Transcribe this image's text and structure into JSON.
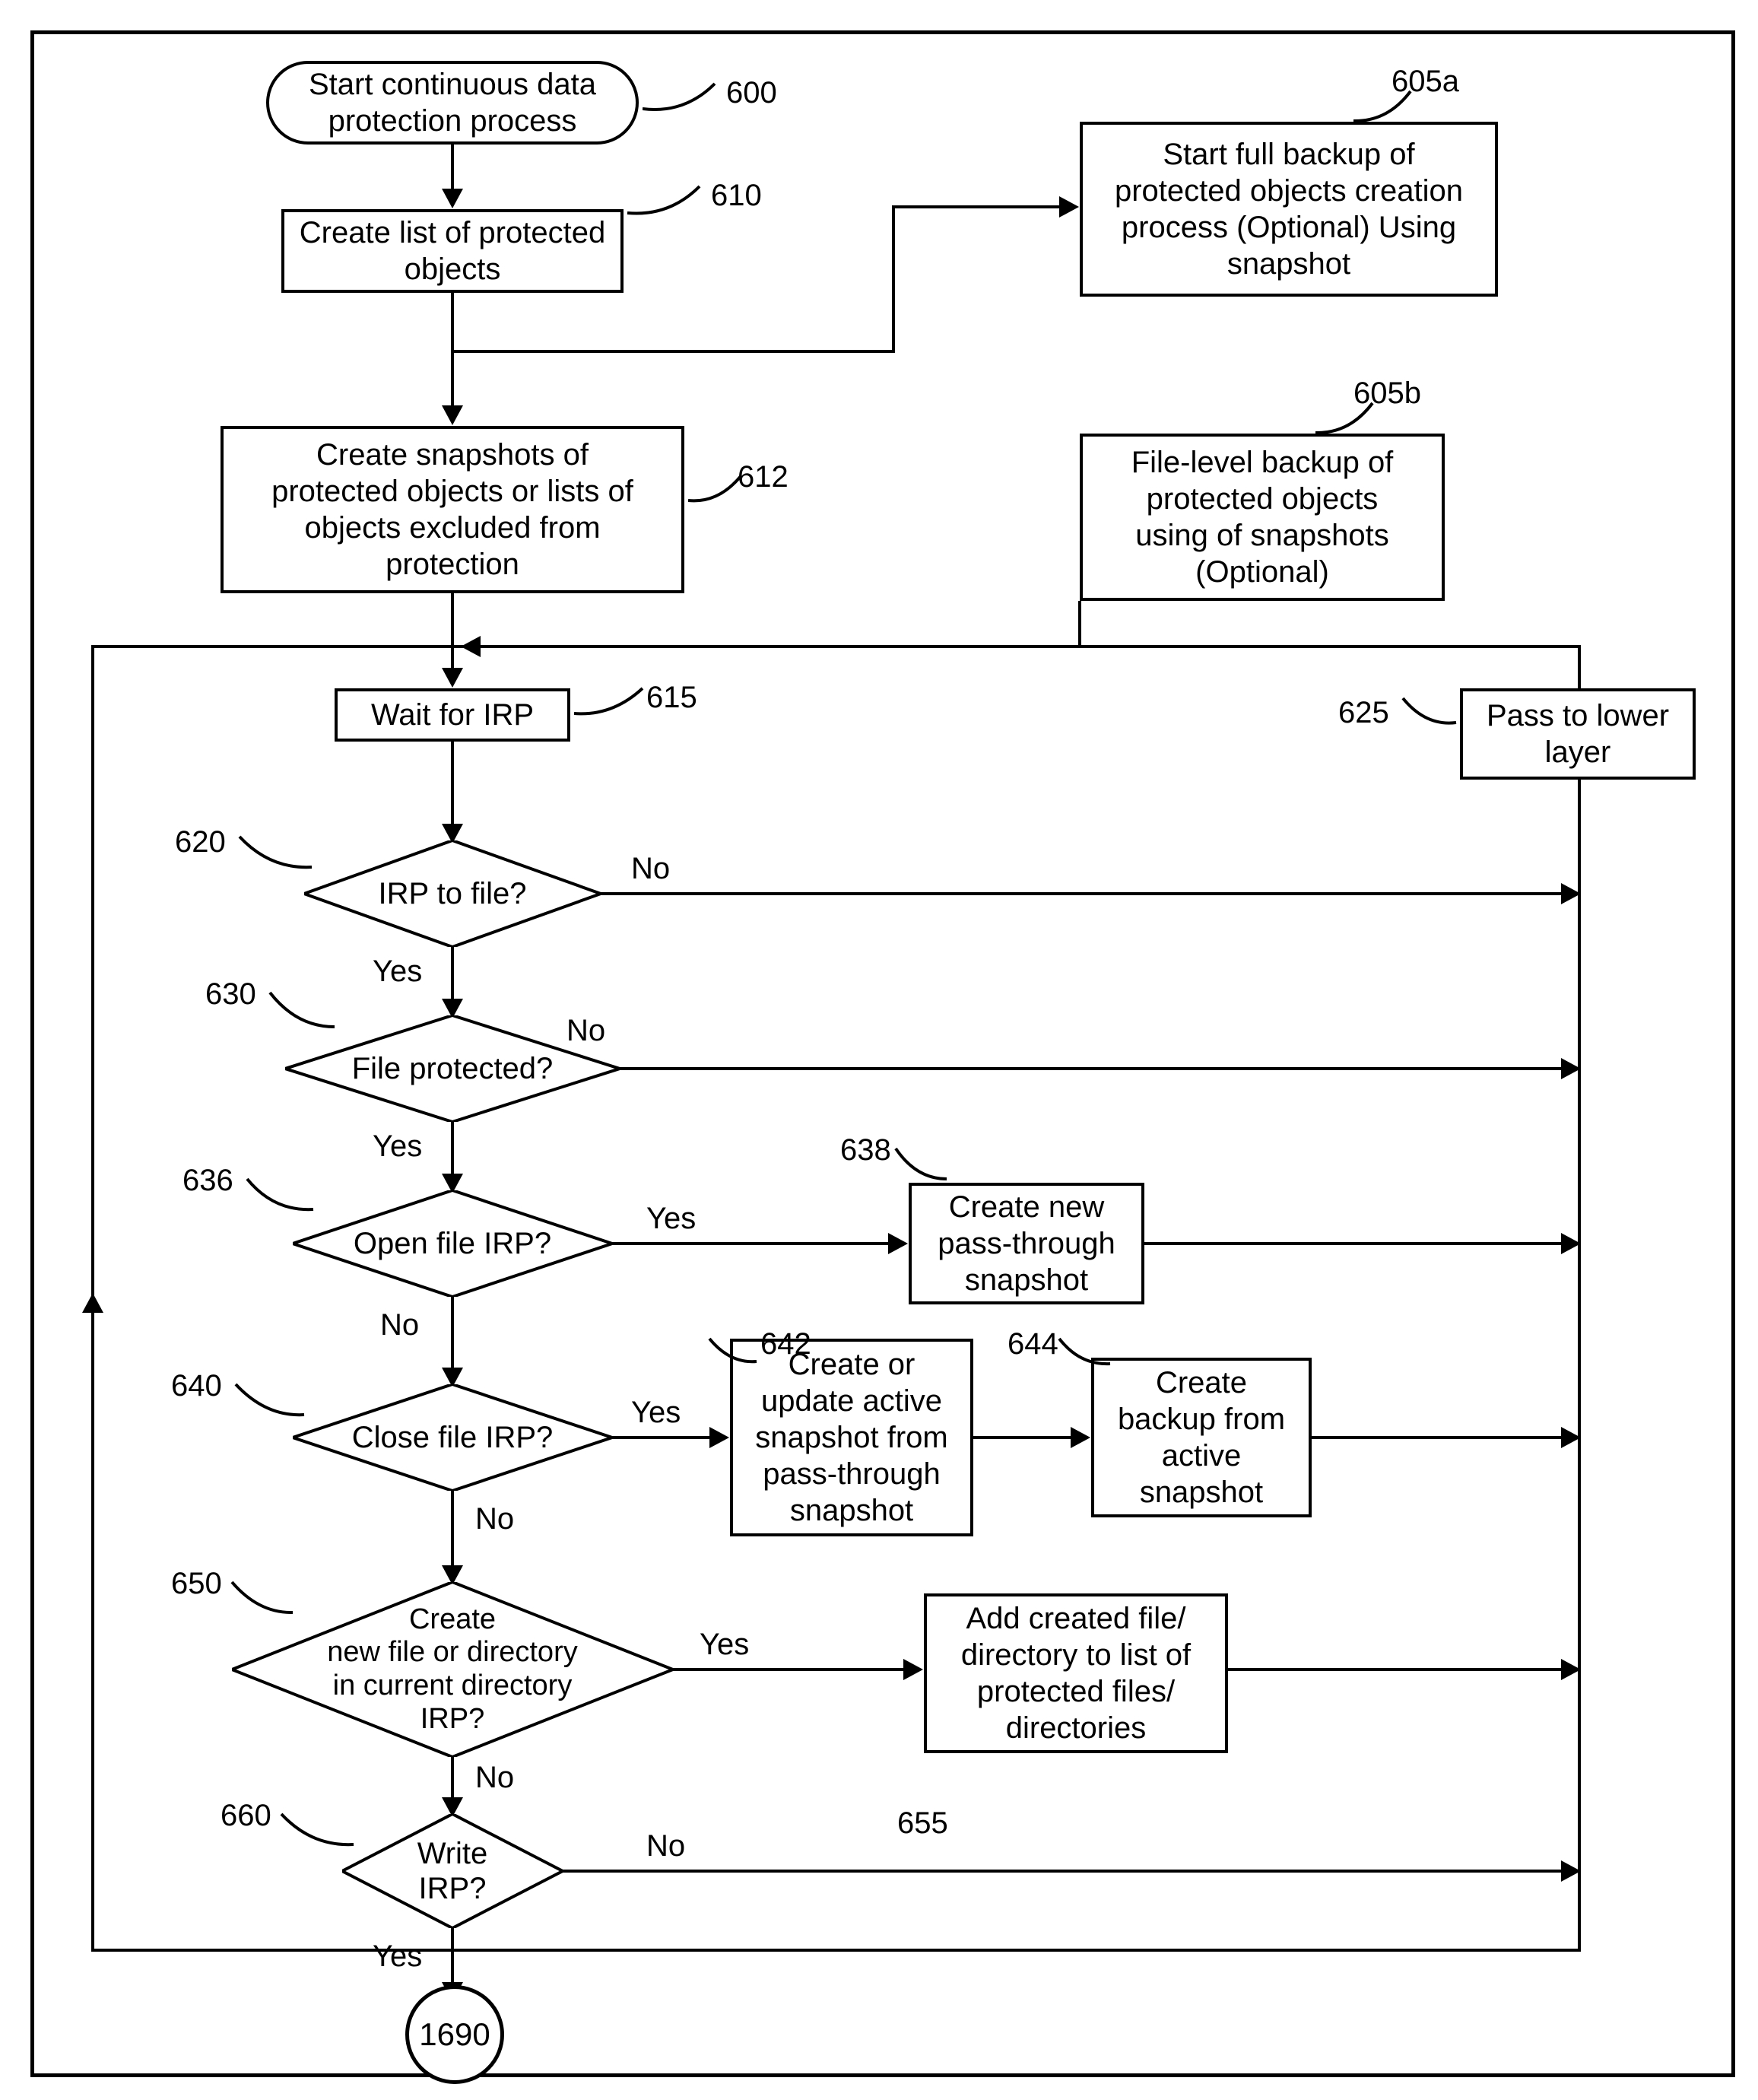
{
  "nodes": {
    "n600": "Start continuous data\nprotection process",
    "n610": "Create list of protected\nobjects",
    "n612": "Create snapshots of\nprotected objects or lists of\nobjects excluded from\nprotection",
    "n605a": "Start full backup of\nprotected objects creation\nprocess (Optional) Using\nsnapshot",
    "n605b": "File-level backup of\nprotected objects\nusing of snapshots\n(Optional)",
    "n615": "Wait for IRP",
    "n625": "Pass to lower\nlayer",
    "d620": "IRP to file?",
    "d630": "File protected?",
    "d636": "Open file IRP?",
    "d640": "Close file IRP?",
    "d650": "Create\nnew file or directory\nin current directory\nIRP?",
    "d660": "Write\nIRP?",
    "n638": "Create new\npass-through\nsnapshot",
    "n642": "Create or\nupdate active\nsnapshot from\npass-through\nsnapshot",
    "n644": "Create\nbackup from\nactive\nsnapshot",
    "n655": "Add created file/\ndirectory to list of\nprotected files/\ndirectories",
    "connector": "1690"
  },
  "refs": {
    "r600": "600",
    "r610": "610",
    "r612": "612",
    "r605a": "605a",
    "r605b": "605b",
    "r615": "615",
    "r625": "625",
    "r620": "620",
    "r630": "630",
    "r636": "636",
    "r638": "638",
    "r640": "640",
    "r642": "642",
    "r644": "644",
    "r650": "650",
    "r655": "655",
    "r660": "660"
  },
  "edges": {
    "yes": "Yes",
    "no": "No"
  }
}
